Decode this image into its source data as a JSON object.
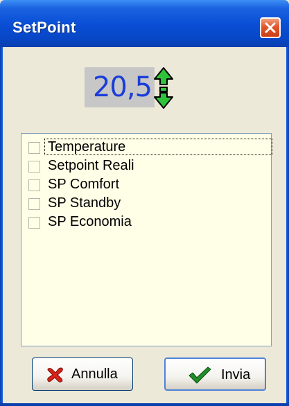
{
  "window": {
    "title": "SetPoint"
  },
  "setpoint": {
    "value": "20,5"
  },
  "list": {
    "items": [
      {
        "label": "Temperature",
        "checked": false
      },
      {
        "label": "Setpoint Reali",
        "checked": false
      },
      {
        "label": "SP Comfort",
        "checked": false
      },
      {
        "label": "SP Standby",
        "checked": false
      },
      {
        "label": "SP Economia",
        "checked": false
      }
    ]
  },
  "buttons": {
    "cancel_label": "Annulla",
    "send_label": "Invia"
  },
  "colors": {
    "titlebar": "#0a4fd6",
    "window_bg": "#ece9d8",
    "list_bg": "#ffffe7",
    "value_text": "#1a3dd8",
    "arrow_green": "#2ec43a"
  },
  "icons": {
    "close": "close-icon",
    "spin": "up-down-arrow-icon",
    "cancel": "red-x-icon",
    "send": "green-check-icon"
  }
}
